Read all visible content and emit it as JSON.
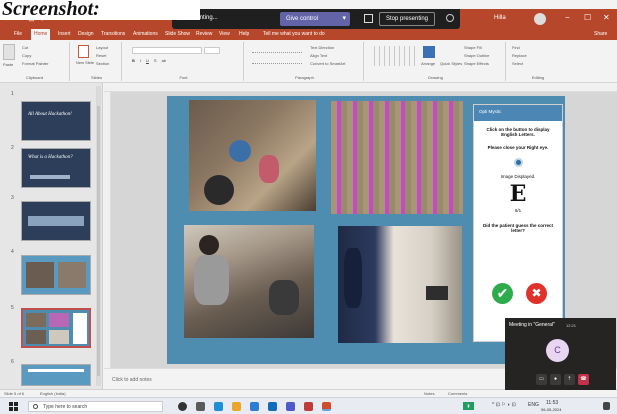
{
  "caption": "Screenshot:",
  "titlebar": {
    "quick_access": "↩ ↪ ⊡ ▾",
    "presenting": "Presenting...",
    "give_control": "Give control",
    "stop_presenting": "Stop presenting",
    "user": "Hilla",
    "window_controls": [
      "−",
      "☐",
      "✕"
    ],
    "brand_color": "#b7472a"
  },
  "tabs": {
    "items": [
      "File",
      "Home",
      "Insert",
      "Design",
      "Transitions",
      "Animations",
      "Slide Show",
      "Review",
      "View",
      "Help"
    ],
    "active": "Home",
    "tell_me": "Tell me what you want to do",
    "share": "Share"
  },
  "ribbon": {
    "clipboard": {
      "paste": "Paste",
      "cut": "Cut",
      "copy": "Copy",
      "format_painter": "Format Painter",
      "label": "Clipboard"
    },
    "slides": {
      "new_slide": "New Slide",
      "layout": "Layout",
      "reset": "Reset",
      "section": "Section",
      "label": "Slides"
    },
    "font": {
      "label": "Font"
    },
    "paragraph": {
      "text_direction": "Text Direction",
      "align_text": "Align Text",
      "convert": "Convert to SmartArt",
      "label": "Paragraph"
    },
    "drawing": {
      "arrange": "Arrange",
      "quick_styles": "Quick Styles",
      "shape_fill": "Shape Fill",
      "shape_outline": "Shape Outline",
      "shape_effects": "Shape Effects",
      "label": "Drawing"
    },
    "editing": {
      "find": "Find",
      "replace": "Replace",
      "select": "Select",
      "label": "Editing"
    }
  },
  "thumbnails": {
    "numbers": [
      "1",
      "2",
      "3",
      "4",
      "5",
      "6"
    ],
    "slide1_title": "All About Hackathon!",
    "slide2_title": "What is a Hackathon?"
  },
  "test_panel": {
    "header": "Opti Mystic",
    "instruction": "Click on the button to display English Letters.",
    "close_eye": "Please close your Right eye.",
    "image_displayed": "Image Displayed.",
    "letter": "E",
    "ratio": "6/1",
    "question": "Did the patient guess the correct letter?",
    "yes_symbol": "✔",
    "no_symbol": "✖"
  },
  "notes": {
    "placeholder": "Click to add notes"
  },
  "statusbar": {
    "slide_info": "Slide 5 of 6",
    "language": "English (India)",
    "notes": "Notes",
    "comments": "Comments"
  },
  "meeting": {
    "title": "Meeting in \"General\"",
    "time": "12:21",
    "avatar_letter": "C"
  },
  "taskbar": {
    "search_placeholder": "Type here to search",
    "tray_lang": "ENG",
    "time": "11:53",
    "date": "06-05-2024"
  },
  "colors": {
    "slide_bg": "#4e8db0",
    "panel_header": "#4b86b4",
    "yes_green": "#2eab4b",
    "no_red": "#e0322a"
  }
}
